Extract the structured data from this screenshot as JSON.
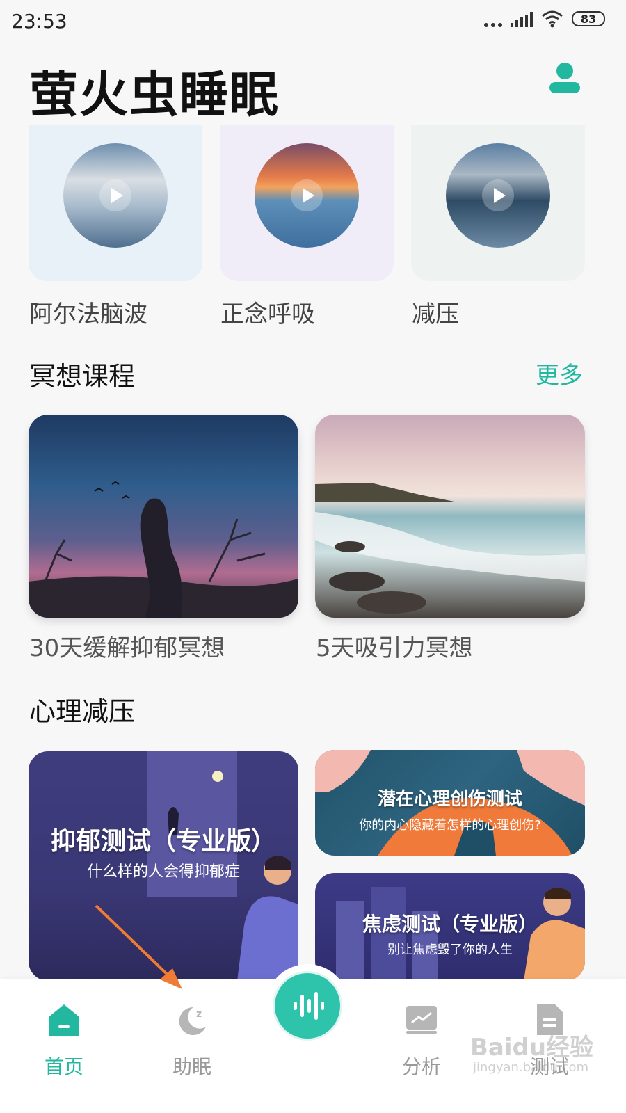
{
  "status_bar": {
    "time": "23:53",
    "battery": "83"
  },
  "header": {
    "title": "萤火虫睡眠"
  },
  "sounds": [
    {
      "label": "阿尔法脑波"
    },
    {
      "label": "正念呼吸"
    },
    {
      "label": "减压"
    }
  ],
  "meditation": {
    "title": "冥想课程",
    "more": "更多",
    "courses": [
      {
        "label": "30天缓解抑郁冥想"
      },
      {
        "label": "5天吸引力冥想"
      }
    ]
  },
  "psychology": {
    "title": "心理减压",
    "tests": [
      {
        "title": "抑郁测试（专业版）",
        "subtitle": "什么样的人会得抑郁症"
      },
      {
        "title": "潜在心理创伤测试",
        "subtitle": "你的内心隐藏着怎样的心理创伤?"
      },
      {
        "title": "焦虑测试（专业版）",
        "subtitle": "别让焦虑毁了你的人生"
      }
    ]
  },
  "bottom_nav": {
    "items": [
      {
        "label": "首页",
        "icon": "home-icon",
        "active": true
      },
      {
        "label": "助眠",
        "icon": "moon-sleep-icon",
        "active": false
      },
      {
        "label": "分析",
        "icon": "chart-icon",
        "active": false
      },
      {
        "label": "测试",
        "icon": "document-icon",
        "active": false
      }
    ],
    "center_icon": "sound-wave-icon"
  },
  "watermark": {
    "main": "Baidu经验",
    "sub": "jingyan.baidu.com"
  },
  "colors": {
    "accent": "#22b8a0",
    "accent_button": "#2ec4ab",
    "annotation_arrow": "#f07b34"
  }
}
